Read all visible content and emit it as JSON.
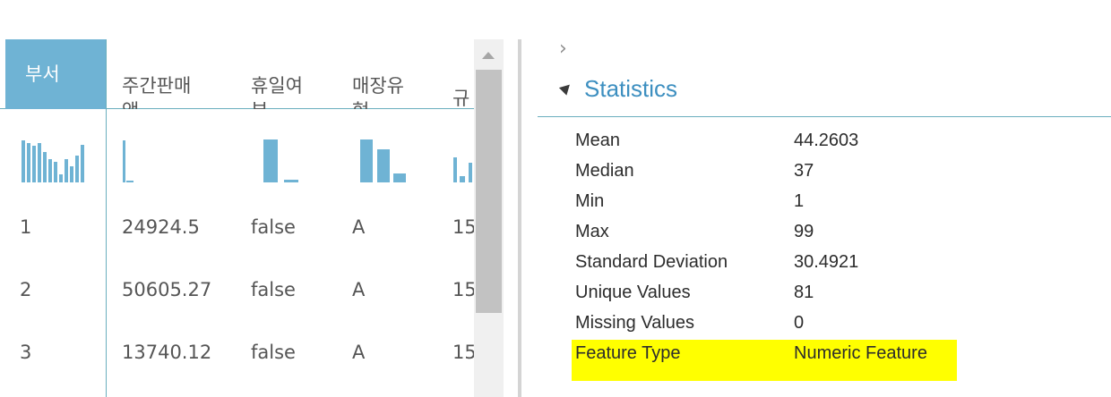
{
  "grid": {
    "selected_column": "부서",
    "columns": [
      {
        "header": "부서"
      },
      {
        "header": "주간판매\n액"
      },
      {
        "header": "휴일여\n부"
      },
      {
        "header": "매장유\n형"
      },
      {
        "header": "규"
      }
    ],
    "rows": [
      [
        "1",
        "24924.5",
        "false",
        "A",
        "15"
      ],
      [
        "2",
        "50605.27",
        "false",
        "A",
        "15"
      ],
      [
        "3",
        "13740.12",
        "false",
        "A",
        "15"
      ]
    ]
  },
  "statistics": {
    "title": "Statistics",
    "items": [
      {
        "label": "Mean",
        "value": "44.2603"
      },
      {
        "label": "Median",
        "value": "37"
      },
      {
        "label": "Min",
        "value": "1"
      },
      {
        "label": "Max",
        "value": "99"
      },
      {
        "label": "Standard Deviation",
        "value": "30.4921"
      },
      {
        "label": "Unique Values",
        "value": "81"
      },
      {
        "label": "Missing Values",
        "value": "0"
      },
      {
        "label": "Feature Type",
        "value": "Numeric Feature"
      }
    ]
  },
  "colors": {
    "accent": "#6fb3d4",
    "title": "#3d8fc0",
    "highlight": "#ffff00"
  },
  "icons": {
    "expand": "chevron-right-icon",
    "collapse": "triangle-collapse-icon",
    "scroll_up": "scroll-up-arrow-icon"
  }
}
